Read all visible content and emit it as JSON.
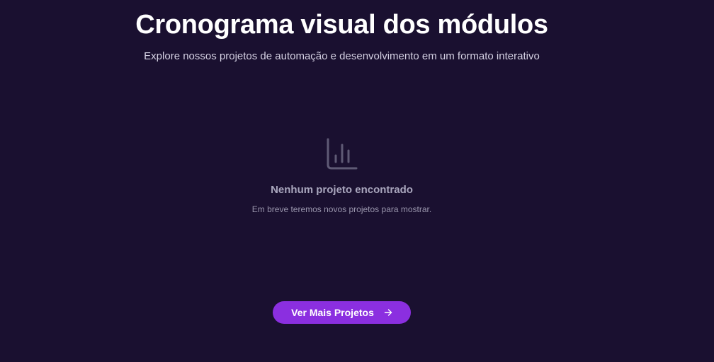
{
  "header": {
    "title": "Cronograma visual dos módulos",
    "subtitle": "Explore nossos projetos de automação e desenvolvimento em um formato interativo"
  },
  "empty_state": {
    "icon": "bar-chart-icon",
    "title": "Nenhum projeto encontrado",
    "message": "Em breve teremos novos projetos para mostrar."
  },
  "actions": {
    "more_label": "Ver Mais Projetos",
    "more_icon": "arrow-right-icon"
  },
  "colors": {
    "background": "#1a1030",
    "accent": "#8b2fe0"
  }
}
